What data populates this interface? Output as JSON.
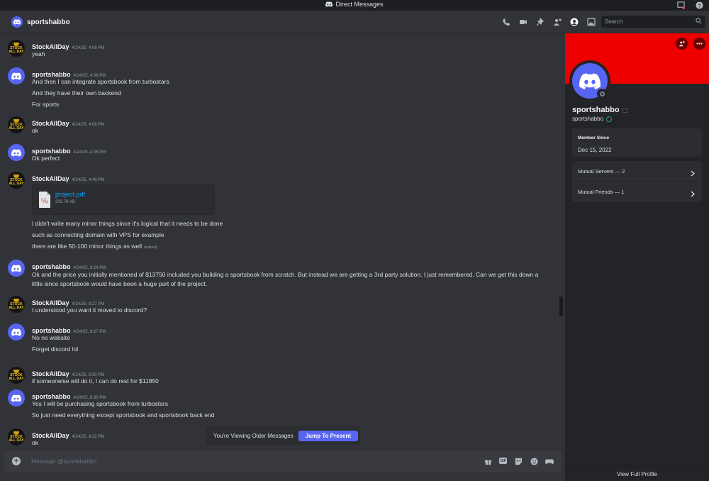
{
  "window": {
    "title": "Direct Messages"
  },
  "header": {
    "username": "sportshabbo",
    "search_placeholder": "Search"
  },
  "messages": [
    {
      "author": "StockAllDay",
      "avatar": "stock",
      "time": "4/24/25, 4:06 PM",
      "lines": [
        "yeah"
      ]
    },
    {
      "author": "sportshabbo",
      "avatar": "discord",
      "time": "4/24/25, 4:06 PM",
      "lines": [
        "And then I can integrate sportsbook from turbostars",
        "And they have their own backend",
        "For sports"
      ]
    },
    {
      "author": "StockAllDay",
      "avatar": "stock",
      "time": "4/24/25, 4:06 PM",
      "lines": [
        "ok"
      ]
    },
    {
      "author": "sportshabbo",
      "avatar": "discord",
      "time": "4/24/25, 4:06 PM",
      "lines": [
        "Ok perfect"
      ]
    },
    {
      "author": "StockAllDay",
      "avatar": "stock",
      "time": "4/24/25, 4:49 PM",
      "attachment": {
        "name": "project.pdf",
        "size": "202.76 KB"
      },
      "lines": [
        "I didn't write many minor things since it's logical that it needs to be done",
        "such as connecting domain with VPS for example",
        "there are like 50-100 minor things as well"
      ],
      "edited_label": "(edited)"
    },
    {
      "author": "sportshabbo",
      "avatar": "discord",
      "time": "4/24/25, 8:24 PM",
      "lines": [
        "Ok and the price you initially mentioned of $13750 included you building a sportsbook from scratch. But instead we are getting a 3rd party solution. I just remembered. Can we get this down a little since sportsbook would have been a huge part of the project."
      ]
    },
    {
      "author": "StockAllDay",
      "avatar": "stock",
      "time": "4/24/25, 8:27 PM",
      "lines": [
        "I understood you want it moved to discord?"
      ]
    },
    {
      "author": "sportshabbo",
      "avatar": "discord",
      "time": "4/24/25, 8:27 PM",
      "lines": [
        "No no website",
        "Forget discord lol"
      ]
    },
    {
      "author": "StockAllDay",
      "avatar": "stock",
      "time": "4/24/25, 8:30 PM",
      "lines": [
        "if someonelse will do it, I can do rest for $11850"
      ]
    },
    {
      "author": "sportshabbo",
      "avatar": "discord",
      "time": "4/24/25, 8:30 PM",
      "lines": [
        "Yes I will be purchasing sportsbook from turbostars",
        "So just need everything except sportsbook and sportsbook back end"
      ]
    },
    {
      "author": "StockAllDay",
      "avatar": "stock",
      "time": "4/24/25, 8:32 PM",
      "lines": [
        "ok"
      ]
    }
  ],
  "older_banner": {
    "text": "You're Viewing Older Messages",
    "button": "Jump To Present"
  },
  "composer": {
    "placeholder": "Message @sportshabbo"
  },
  "stock_avatar": {
    "line1": "STOCK",
    "line2": "ALL DAY"
  },
  "profile": {
    "display_name": "sportshabbo",
    "username": "sportshabbo",
    "banner_color": "#ee0000",
    "member_since_label": "Member Since",
    "member_since": "Dec 15, 2022",
    "mutual_servers": "Mutual Servers — 2",
    "mutual_friends": "Mutual Friends — 1",
    "view_full": "View Full Profile"
  },
  "colors": {
    "accent": "#5865f2",
    "link": "#00a8fc"
  }
}
